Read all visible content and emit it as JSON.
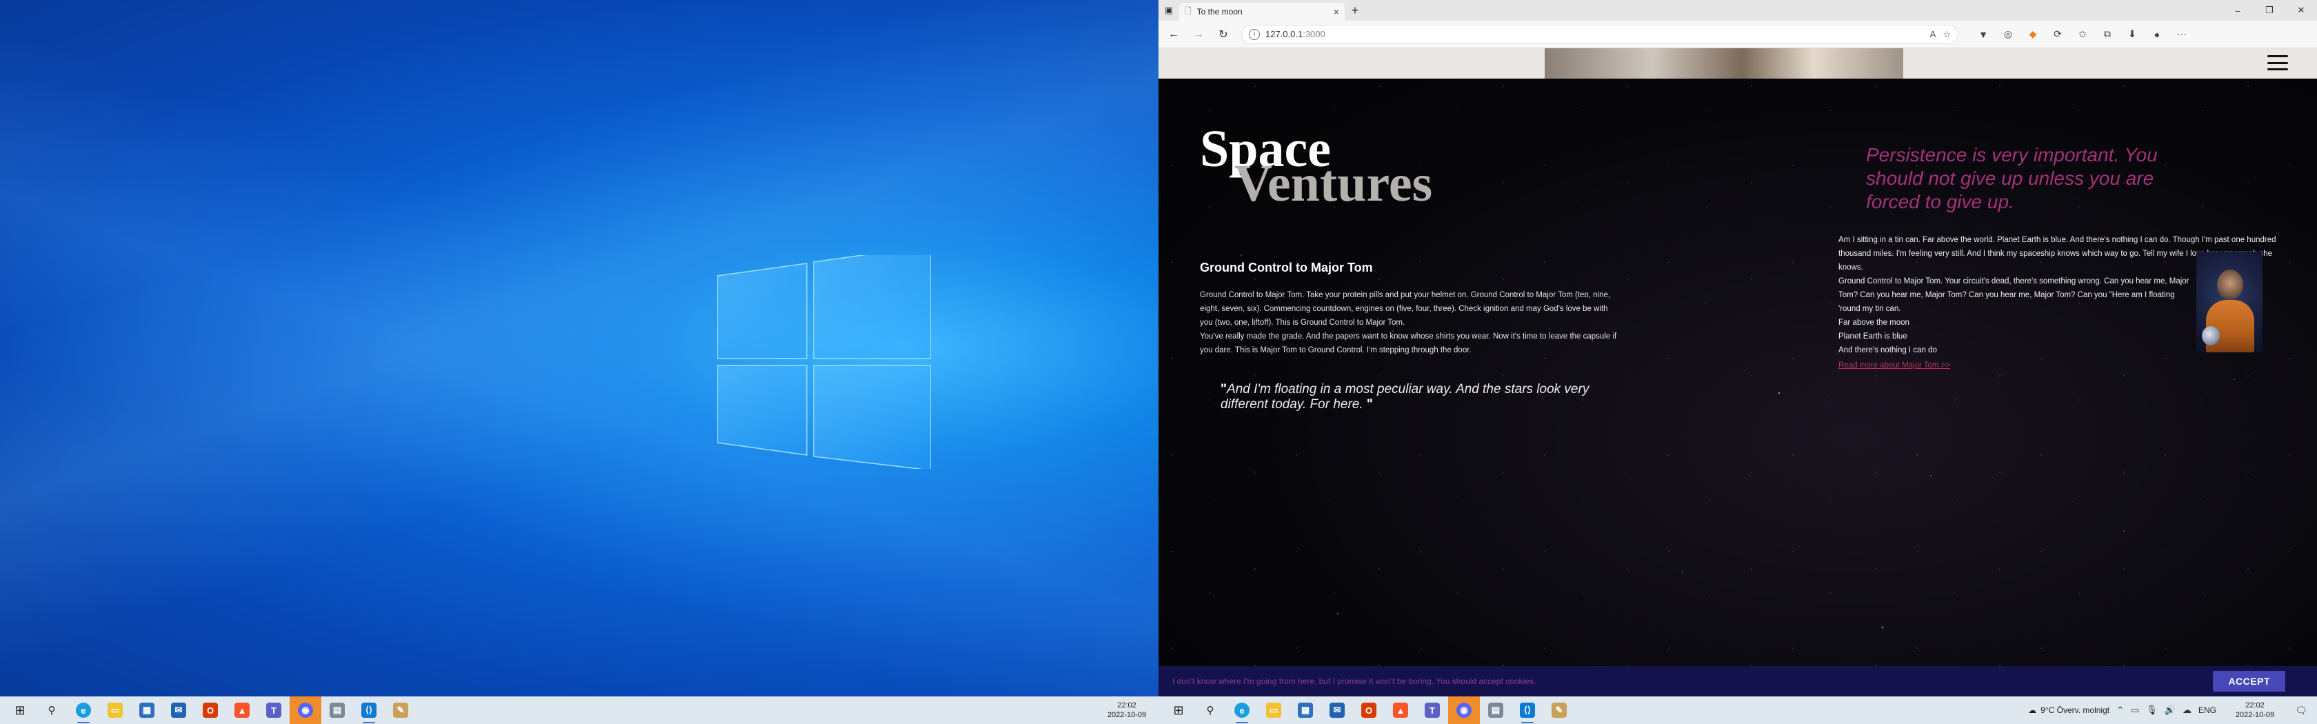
{
  "browser": {
    "tab_title": "To the moon",
    "url_host": "127.0.0.1",
    "url_port": ":3000"
  },
  "page": {
    "logo_line1": "Space",
    "logo_line2": "Ventures",
    "section_title": "Ground Control to Major Tom",
    "section_paragraphs": [
      "Ground Control to Major Tom. Take your protein pills and put your helmet on. Ground Control to Major Tom (ten, nine, eight, seven, six). Commencing countdown, engines on (five, four, three). Check ignition and may God's love be with you (two, one, liftoff). This is Ground Control to Major Tom.",
      "You've really made the grade. And the papers want to know whose shirts you wear. Now it's time to leave the capsule if you dare. This is Major Tom to Ground Control. I'm stepping through the door."
    ],
    "quote_left": "And I'm floating in a most peculiar way. And the stars look very different today. For here.",
    "quote_right": "Persistence is very important. You should not give up unless you are forced to give up.",
    "aside_paragraphs": [
      "Am I sitting in a tin can. Far above the world. Planet Earth is blue. And there's nothing I can do. Though I'm past one hundred thousand miles. I'm feeling very still. And I think my spaceship knows which way to go. Tell my wife I love her very much she knows.",
      "Ground Control to Major Tom. Your circuit's dead, there's something wrong. Can you hear me, Major Tom? Can you hear me, Major Tom? Can you hear me, Major Tom? Can you \"Here am I floating 'round my tin can.",
      "Far above the moon",
      "Planet Earth is blue",
      "And there's nothing I can do"
    ],
    "aside_link": "Read more about Major Tom >>",
    "cookie_text": "I don't know where I'm going from here, but I promise it won't be boring. You should accept cookies.",
    "accept_label": "ACCEPT"
  },
  "taskbar_left": {
    "time": "22:02",
    "date": "2022-10-09"
  },
  "taskbar_right": {
    "weather": "9°C  Överv. molnigt",
    "lang": "ENG",
    "time": "22:02",
    "date": "2022-10-09"
  },
  "icons": {
    "taskbar_apps": [
      "start-icon",
      "search-icon",
      "edge-icon",
      "file-explorer-icon",
      "store-icon",
      "mail-icon",
      "office-icon",
      "brave-icon",
      "teams-icon",
      "discord-icon",
      "terminal-icon",
      "vscode-icon",
      "paint-icon"
    ]
  },
  "colors": {
    "wallpaper": "#0a5fd0",
    "quote_accent": "#a6317a",
    "cookie_bar": "#13124d",
    "accept_button": "#4747b8",
    "discord_active": "#f08c2c"
  }
}
